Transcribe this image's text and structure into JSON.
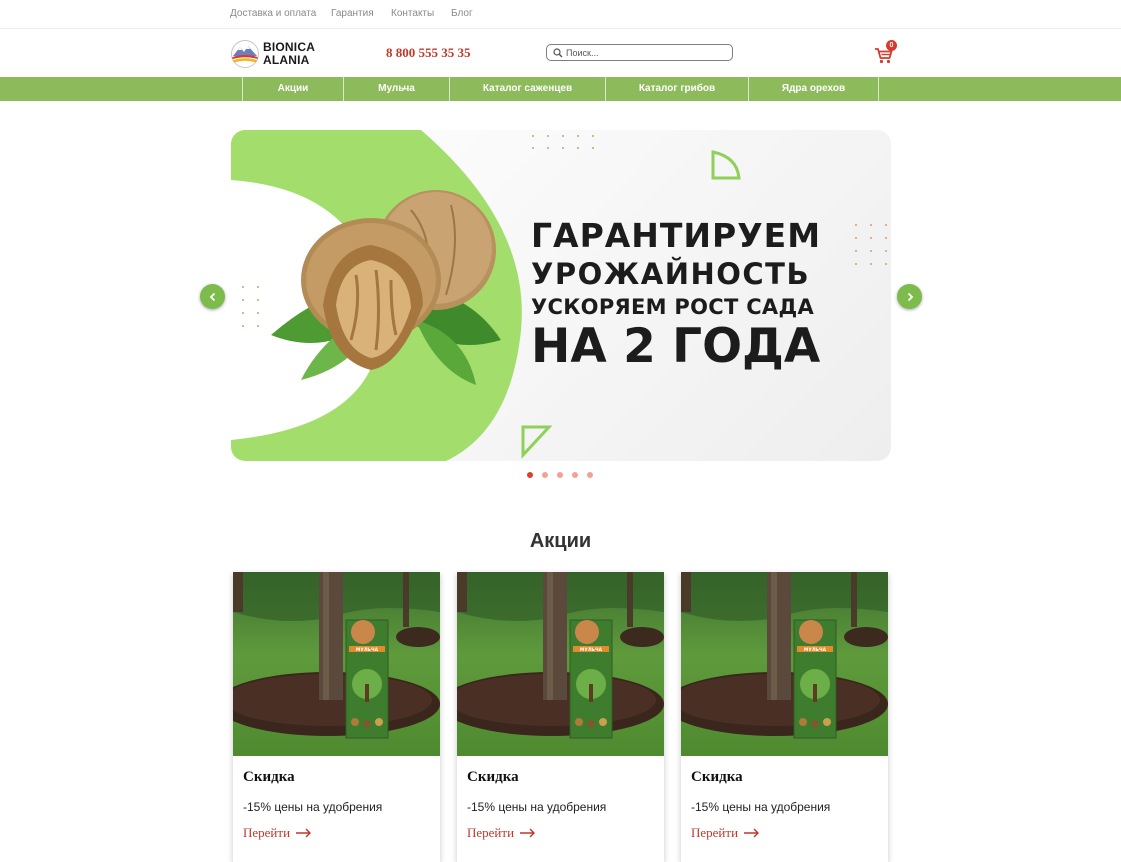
{
  "top_links": [
    "Доставка и оплата",
    "Гарантия",
    "Контакты",
    "Блог"
  ],
  "header": {
    "logo_line1": "BIONICA",
    "logo_line2": "ALANIA",
    "phone": "8 800 555 35 35",
    "search_placeholder": "Поиск...",
    "cart_count": "0"
  },
  "nav": [
    "Акции",
    "Мульча",
    "Каталог саженцев",
    "Каталог грибов",
    "Ядра орехов"
  ],
  "banner": {
    "line1": "ГАРАНТИРУЕМ",
    "line2": "УРОЖАЙНОСТЬ",
    "line3": "УСКОРЯЕМ РОСТ САДА",
    "line4": "НА 2 ГОДА",
    "slide_count": 5,
    "active_slide": 1,
    "accent_color": "#a3de6c"
  },
  "section_title": "Акции",
  "cards": [
    {
      "title": "Скидка",
      "desc": "-15% цены на удобрения",
      "link": "Перейти",
      "package_label": "МУЛЬЧА"
    },
    {
      "title": "Скидка",
      "desc": "-15% цены на удобрения",
      "link": "Перейти",
      "package_label": "МУЛЬЧА"
    },
    {
      "title": "Скидка",
      "desc": "-15% цены на удобрения",
      "link": "Перейти",
      "package_label": "МУЛЬЧА"
    }
  ],
  "colors": {
    "nav_green": "#8dbb5b",
    "accent_red": "#c0392b",
    "arrow_green": "#7dbb4d"
  }
}
